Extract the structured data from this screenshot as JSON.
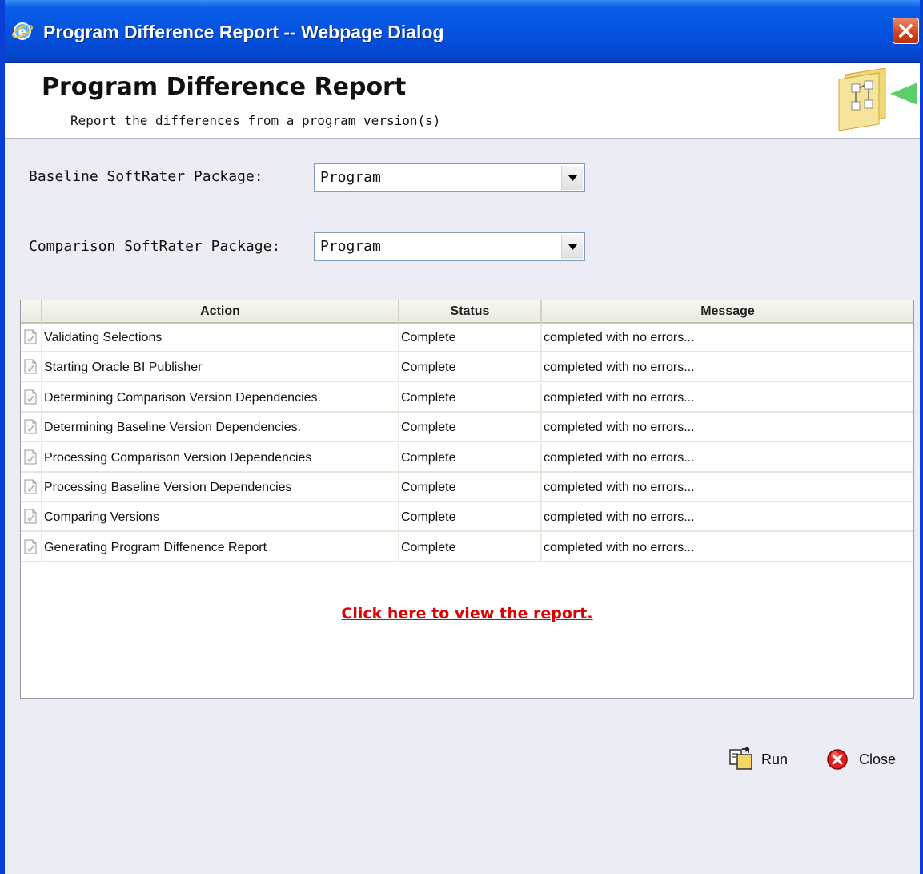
{
  "window": {
    "title": "Program Difference Report -- Webpage Dialog"
  },
  "header": {
    "title": "Program Difference Report",
    "subtitle": "Report the differences from a program version(s)"
  },
  "form": {
    "baseline": {
      "label": "Baseline SoftRater Package:",
      "value": "Program"
    },
    "comparison": {
      "label": "Comparison SoftRater Package:",
      "value": "Program"
    }
  },
  "table": {
    "columns": [
      "Action",
      "Status",
      "Message"
    ],
    "rows": [
      {
        "action": "Validating Selections",
        "status": "Complete",
        "message": "completed with no errors..."
      },
      {
        "action": "Starting Oracle BI Publisher",
        "status": "Complete",
        "message": "completed with no errors..."
      },
      {
        "action": "Determining Comparison Version Dependencies.",
        "status": "Complete",
        "message": "completed with no errors..."
      },
      {
        "action": "Determining Baseline Version Dependencies.",
        "status": "Complete",
        "message": "completed with no errors..."
      },
      {
        "action": "Processing Comparison Version Dependencies",
        "status": "Complete",
        "message": "completed with no errors..."
      },
      {
        "action": "Processing Baseline Version Dependencies",
        "status": "Complete",
        "message": "completed with no errors..."
      },
      {
        "action": "Comparing Versions",
        "status": "Complete",
        "message": "completed with no errors..."
      },
      {
        "action": "Generating Program Diffenence Report",
        "status": "Complete",
        "message": "completed with no errors..."
      }
    ],
    "link_text": "Click here to view the report."
  },
  "buttons": {
    "run": "Run",
    "close": "Close"
  },
  "colors": {
    "titlebar": "#0552e0",
    "background": "#ececf5",
    "link": "#e10000",
    "close_button": "#d0431a"
  },
  "icons": {
    "titlebar": "ie-icon",
    "window_close": "close-x-icon",
    "header_graphic": "report-graphic-icon",
    "row": "document-icon",
    "run": "run-icon",
    "close": "close-circle-icon"
  }
}
